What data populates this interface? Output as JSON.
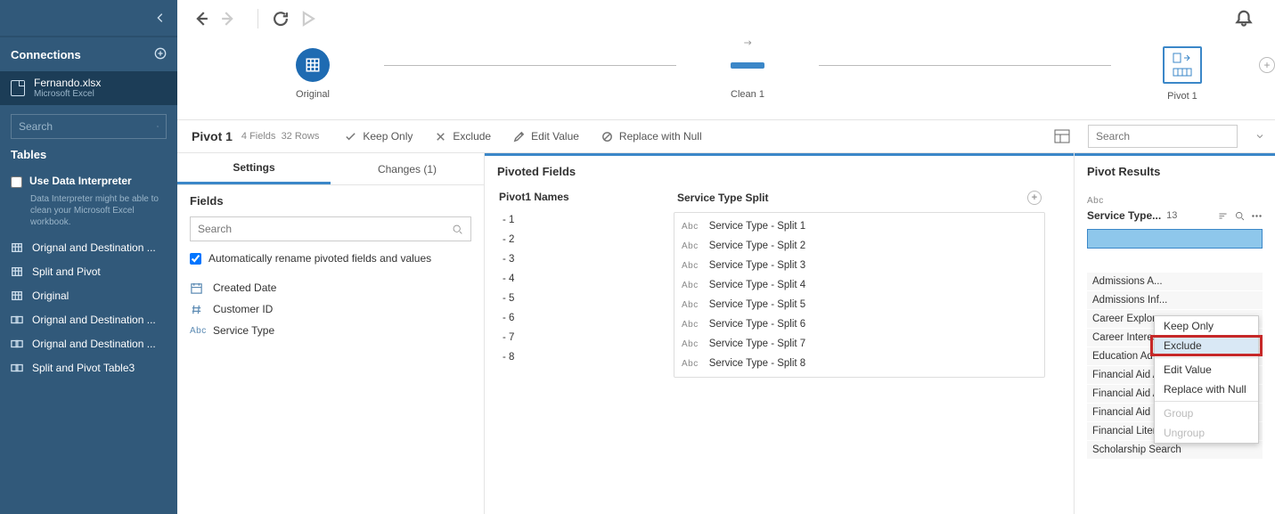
{
  "sidebar": {
    "connections_label": "Connections",
    "connection": {
      "name": "Fernando.xlsx",
      "type": "Microsoft Excel"
    },
    "search_placeholder": "Search",
    "tables_label": "Tables",
    "interpreter_label": "Use Data Interpreter",
    "interpreter_hint": "Data Interpreter might be able to clean your Microsoft Excel workbook.",
    "tables": [
      {
        "icon": "single",
        "label": "Orignal and Destination ..."
      },
      {
        "icon": "single",
        "label": "Split and Pivot"
      },
      {
        "icon": "single",
        "label": "Original"
      },
      {
        "icon": "join",
        "label": "Orignal and Destination ..."
      },
      {
        "icon": "join",
        "label": "Orignal and Destination ..."
      },
      {
        "icon": "join",
        "label": "Split and Pivot Table3"
      }
    ]
  },
  "flow": {
    "nodes": [
      {
        "label": "Original"
      },
      {
        "label": "Clean 1"
      },
      {
        "label": "Pivot 1"
      }
    ]
  },
  "pivot_bar": {
    "title": "Pivot 1",
    "fields_label": "4 Fields",
    "rows_label": "32 Rows",
    "keep_only": "Keep Only",
    "exclude": "Exclude",
    "edit_value": "Edit Value",
    "replace_null": "Replace with Null",
    "search_placeholder": "Search"
  },
  "tabs": {
    "settings": "Settings",
    "changes": "Changes (1)"
  },
  "fields_panel": {
    "head": "Fields",
    "search_placeholder": "Search",
    "auto_rename": "Automatically rename pivoted fields and values",
    "items": [
      {
        "icon": "date",
        "label": "Created Date"
      },
      {
        "icon": "hash",
        "label": "Customer ID"
      },
      {
        "icon": "abc",
        "label": "Service Type"
      }
    ]
  },
  "pivoted": {
    "head": "Pivoted Fields",
    "names_head": "Pivot1 Names",
    "split_head": "Service Type Split",
    "names": [
      " - 1",
      " - 2",
      " - 3",
      " - 4",
      " - 5",
      " - 6",
      " - 7",
      " - 8"
    ],
    "splits": [
      "Service Type - Split 1",
      "Service Type - Split 2",
      "Service Type - Split 3",
      "Service Type - Split 4",
      "Service Type - Split 5",
      "Service Type - Split 6",
      "Service Type - Split 7",
      "Service Type - Split 8"
    ]
  },
  "results": {
    "head": "Pivot Results",
    "abc": "Abc",
    "field": "Service Type...",
    "count": "13",
    "values": [
      "Admissions A...",
      "Admissions Inf...",
      "Career Explora...",
      "Career Interest...",
      "Education Advi...",
      "Financial Aid A...",
      "Financial Aid Applicati...",
      "Financial Aid Info",
      "Financial Literacy",
      "Scholarship Search"
    ]
  },
  "ctx_menu": {
    "keep_only": "Keep Only",
    "exclude": "Exclude",
    "edit_value": "Edit Value",
    "replace_null": "Replace with Null",
    "group": "Group",
    "ungroup": "Ungroup"
  }
}
